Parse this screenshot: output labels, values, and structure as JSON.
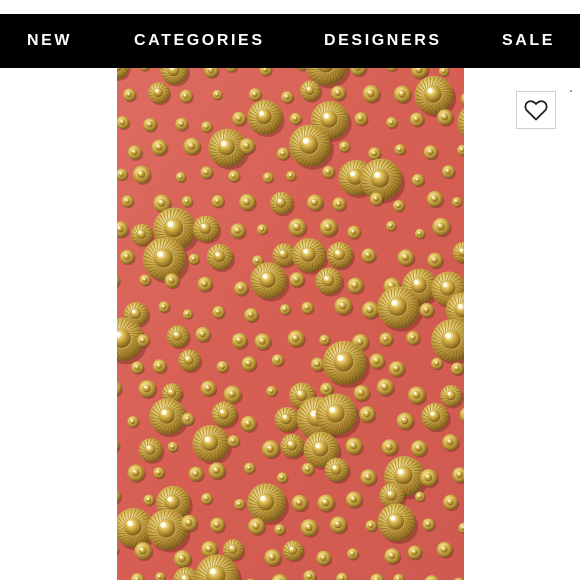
{
  "nav": {
    "items": [
      {
        "label": "NEW"
      },
      {
        "label": "CATEGORIES"
      },
      {
        "label": "DESIGNERS"
      },
      {
        "label": "SALE"
      }
    ]
  },
  "product_image": {
    "fabric_color": "#d9655a",
    "stud_color": "#d8b24c"
  },
  "actions": {
    "like_icon": "heart-outline-icon"
  },
  "colors": {
    "nav_background": "#000000",
    "nav_text": "#ffffff"
  }
}
